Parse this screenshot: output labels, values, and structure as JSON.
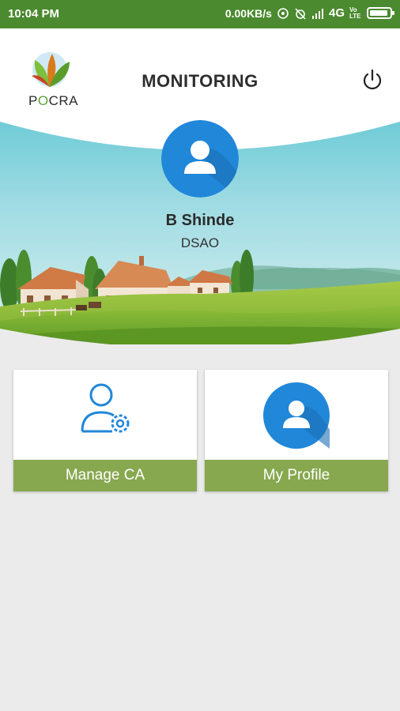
{
  "status_bar": {
    "time": "10:04 PM",
    "network_speed": "0.00KB/s",
    "network_type": "4G",
    "lte_label": "Vo LTE",
    "icons": [
      "hotspot-icon",
      "alarm-off-icon",
      "signal-icon",
      "battery-icon"
    ]
  },
  "header": {
    "title": "MONITORING",
    "logo_text": "POCRA"
  },
  "profile": {
    "name": "B Shinde",
    "role": "DSAO"
  },
  "cards": [
    {
      "label": "Manage CA",
      "icon": "manage-user-gear-icon"
    },
    {
      "label": "My Profile",
      "icon": "profile-avatar-icon"
    }
  ],
  "colors": {
    "status_bar": "#4b8a2f",
    "card_footer": "#87a84f",
    "avatar_blue": "#2187d9",
    "background": "#ebebeb"
  }
}
